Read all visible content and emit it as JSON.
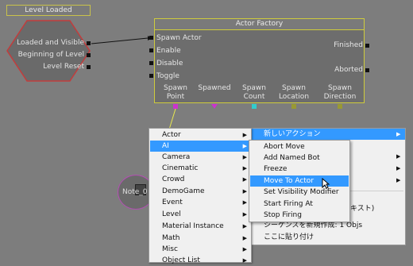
{
  "event_node": {
    "title": "Level Loaded",
    "outputs": [
      "Loaded and Visible",
      "Beginning of Level",
      "Level Reset"
    ]
  },
  "factory_node": {
    "title": "Actor Factory",
    "inputs": [
      "Spawn Actor",
      "Enable",
      "Disable",
      "Toggle"
    ],
    "outputs": [
      "Finished",
      "Aborted"
    ],
    "variables": [
      {
        "line1": "Spawn",
        "line2": "Point",
        "color": "#cc33cc"
      },
      {
        "line1": "Spawned",
        "line2": "",
        "color": "#cc33cc"
      },
      {
        "line1": "Spawn",
        "line2": "Count",
        "color": "#33cccc"
      },
      {
        "line1": "Spawn",
        "line2": "Location",
        "color": "#999933"
      },
      {
        "line1": "Spawn",
        "line2": "Direction",
        "color": "#999933"
      }
    ]
  },
  "note_node": {
    "label": "Note_0"
  },
  "context_menu": {
    "items": [
      {
        "label": "Actor",
        "submenu": true
      },
      {
        "label": "AI",
        "submenu": true,
        "selected": true
      },
      {
        "label": "Camera",
        "submenu": true
      },
      {
        "label": "Cinematic",
        "submenu": true
      },
      {
        "label": "Crowd",
        "submenu": true
      },
      {
        "label": "DemoGame",
        "submenu": true
      },
      {
        "label": "Event",
        "submenu": true
      },
      {
        "label": "Level",
        "submenu": true
      },
      {
        "label": "Material Instance",
        "submenu": true
      },
      {
        "label": "Math",
        "submenu": true
      },
      {
        "label": "Misc",
        "submenu": true
      },
      {
        "label": "Object List",
        "submenu": true
      }
    ]
  },
  "ai_submenu": {
    "items": [
      {
        "label": "Abort Move"
      },
      {
        "label": "Add Named Bot"
      },
      {
        "label": "Freeze"
      },
      {
        "label": "Move To Actor",
        "selected": true
      },
      {
        "label": "Set Visibility Modifier"
      },
      {
        "label": "Start Firing At"
      },
      {
        "label": "Stop Firing"
      }
    ]
  },
  "back_menu": {
    "header": "新しいアクション",
    "partial_item": "キスト)",
    "items": [
      "シーケンスを新規作成: 1 Objs",
      "ここに貼り付け"
    ]
  },
  "colors": {
    "canvas": "#7d7d7d",
    "node_border": "#cfcc3c",
    "selection": "#3399ff",
    "event_fill": "#6a6a6a",
    "event_border": "#c23c3c"
  },
  "icons": {
    "submenu_arrow": "▶",
    "cursor": "arrow-cursor-icon",
    "note": "note-icon"
  }
}
